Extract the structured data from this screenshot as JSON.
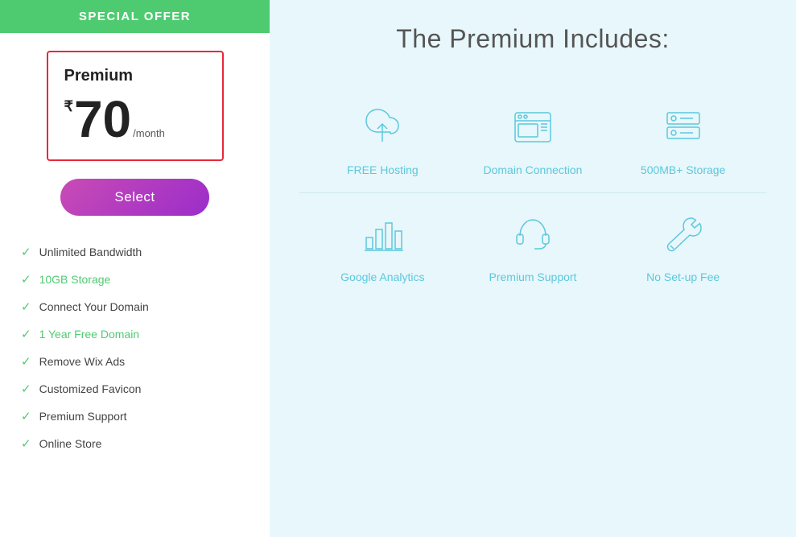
{
  "header": {
    "special_offer": "SPECIAL OFFER"
  },
  "plan": {
    "name": "Premium",
    "currency": "₹",
    "price": "70",
    "per_month": "/month"
  },
  "select_button": "Select",
  "features": [
    {
      "id": "bandwidth",
      "text": "Unlimited Bandwidth",
      "highlight": false
    },
    {
      "id": "storage",
      "text": "10GB Storage",
      "highlight": true
    },
    {
      "id": "domain",
      "text": "Connect Your Domain",
      "highlight": false
    },
    {
      "id": "free_domain",
      "text": "1 Year Free Domain",
      "highlight": true
    },
    {
      "id": "wix_ads",
      "text": "Remove Wix Ads",
      "highlight": false
    },
    {
      "id": "favicon",
      "text": "Customized Favicon",
      "highlight": false
    },
    {
      "id": "support",
      "text": "Premium Support",
      "highlight": false
    },
    {
      "id": "store",
      "text": "Online Store",
      "highlight": false
    }
  ],
  "right_panel": {
    "title": "The Premium Includes:",
    "items_row1": [
      {
        "id": "free-hosting",
        "label": "FREE Hosting"
      },
      {
        "id": "domain-connection",
        "label": "Domain Connection"
      },
      {
        "id": "storage-500",
        "label": "500MB+ Storage"
      }
    ],
    "items_row2": [
      {
        "id": "google-analytics",
        "label": "Google Analytics"
      },
      {
        "id": "premium-support",
        "label": "Premium Support"
      },
      {
        "id": "no-setup-fee",
        "label": "No Set-up Fee"
      }
    ]
  }
}
